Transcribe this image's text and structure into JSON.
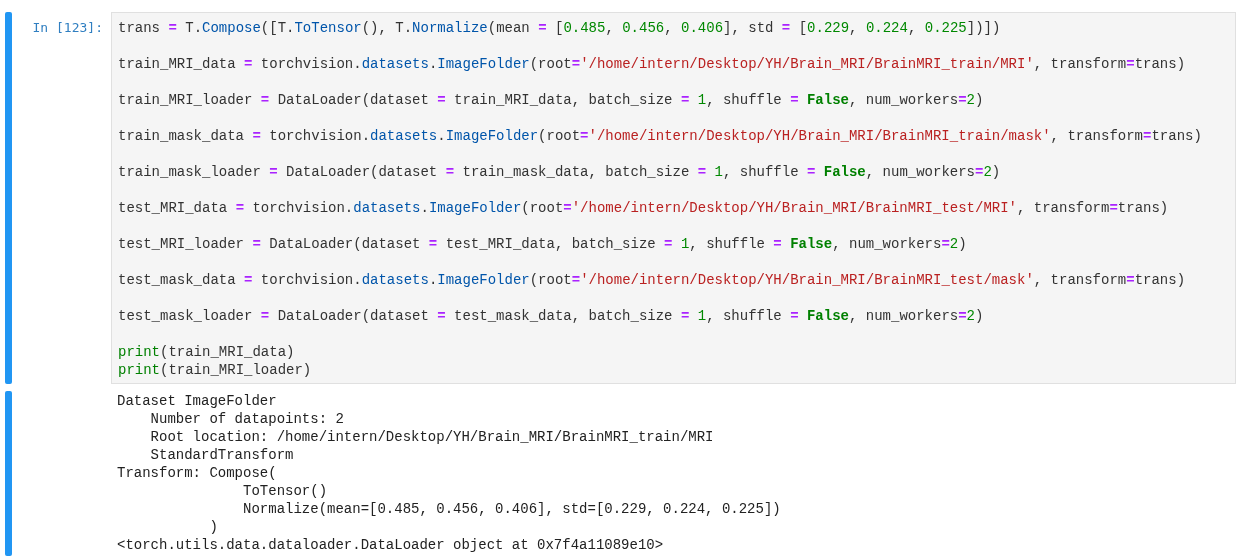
{
  "input_cell": {
    "prompt": "In [123]:",
    "blocks": [
      [
        [
          {
            "kind": "plain",
            "text": "trans "
          },
          {
            "kind": "op",
            "text": "="
          },
          {
            "kind": "plain",
            "text": " T."
          },
          {
            "kind": "prop",
            "text": "Compose"
          },
          {
            "kind": "plain",
            "text": "([T."
          },
          {
            "kind": "prop",
            "text": "ToTensor"
          },
          {
            "kind": "plain",
            "text": "(), T."
          },
          {
            "kind": "prop",
            "text": "Normalize"
          },
          {
            "kind": "plain",
            "text": "(mean "
          },
          {
            "kind": "op",
            "text": "="
          },
          {
            "kind": "plain",
            "text": " ["
          },
          {
            "kind": "num",
            "text": "0.485"
          },
          {
            "kind": "plain",
            "text": ", "
          },
          {
            "kind": "num",
            "text": "0.456"
          },
          {
            "kind": "plain",
            "text": ", "
          },
          {
            "kind": "num",
            "text": "0.406"
          },
          {
            "kind": "plain",
            "text": "], std "
          },
          {
            "kind": "op",
            "text": "="
          },
          {
            "kind": "plain",
            "text": " ["
          },
          {
            "kind": "num",
            "text": "0.229"
          },
          {
            "kind": "plain",
            "text": ", "
          },
          {
            "kind": "num",
            "text": "0.224"
          },
          {
            "kind": "plain",
            "text": ", "
          },
          {
            "kind": "num",
            "text": "0.225"
          },
          {
            "kind": "plain",
            "text": "])])"
          }
        ]
      ],
      [
        [
          {
            "kind": "plain",
            "text": "train_MRI_data "
          },
          {
            "kind": "op",
            "text": "="
          },
          {
            "kind": "plain",
            "text": " torchvision."
          },
          {
            "kind": "prop",
            "text": "datasets"
          },
          {
            "kind": "plain",
            "text": "."
          },
          {
            "kind": "prop",
            "text": "ImageFolder"
          },
          {
            "kind": "plain",
            "text": "(root"
          },
          {
            "kind": "op",
            "text": "="
          },
          {
            "kind": "str",
            "text": "'/home/intern/Desktop/YH/Brain_MRI/BrainMRI_train/MRI'"
          },
          {
            "kind": "plain",
            "text": ", transform"
          },
          {
            "kind": "op",
            "text": "="
          },
          {
            "kind": "plain",
            "text": "trans)"
          }
        ]
      ],
      [
        [
          {
            "kind": "plain",
            "text": "train_MRI_loader "
          },
          {
            "kind": "op",
            "text": "="
          },
          {
            "kind": "plain",
            "text": " DataLoader(dataset "
          },
          {
            "kind": "op",
            "text": "="
          },
          {
            "kind": "plain",
            "text": " train_MRI_data, batch_size "
          },
          {
            "kind": "op",
            "text": "= "
          },
          {
            "kind": "num",
            "text": "1"
          },
          {
            "kind": "plain",
            "text": ", shuffle "
          },
          {
            "kind": "op",
            "text": "= "
          },
          {
            "kind": "kw",
            "text": "False"
          },
          {
            "kind": "plain",
            "text": ", num_workers"
          },
          {
            "kind": "op",
            "text": "="
          },
          {
            "kind": "num",
            "text": "2"
          },
          {
            "kind": "plain",
            "text": ")"
          }
        ]
      ],
      [
        [
          {
            "kind": "plain",
            "text": "train_mask_data "
          },
          {
            "kind": "op",
            "text": "="
          },
          {
            "kind": "plain",
            "text": " torchvision."
          },
          {
            "kind": "prop",
            "text": "datasets"
          },
          {
            "kind": "plain",
            "text": "."
          },
          {
            "kind": "prop",
            "text": "ImageFolder"
          },
          {
            "kind": "plain",
            "text": "(root"
          },
          {
            "kind": "op",
            "text": "="
          },
          {
            "kind": "str",
            "text": "'/home/intern/Desktop/YH/Brain_MRI/BrainMRI_train/mask'"
          },
          {
            "kind": "plain",
            "text": ", transform"
          },
          {
            "kind": "op",
            "text": "="
          },
          {
            "kind": "plain",
            "text": "trans)"
          }
        ]
      ],
      [
        [
          {
            "kind": "plain",
            "text": "train_mask_loader "
          },
          {
            "kind": "op",
            "text": "="
          },
          {
            "kind": "plain",
            "text": " DataLoader(dataset "
          },
          {
            "kind": "op",
            "text": "="
          },
          {
            "kind": "plain",
            "text": " train_mask_data, batch_size "
          },
          {
            "kind": "op",
            "text": "= "
          },
          {
            "kind": "num",
            "text": "1"
          },
          {
            "kind": "plain",
            "text": ", shuffle "
          },
          {
            "kind": "op",
            "text": "= "
          },
          {
            "kind": "kw",
            "text": "False"
          },
          {
            "kind": "plain",
            "text": ", num_workers"
          },
          {
            "kind": "op",
            "text": "="
          },
          {
            "kind": "num",
            "text": "2"
          },
          {
            "kind": "plain",
            "text": ")"
          }
        ]
      ],
      [
        [
          {
            "kind": "plain",
            "text": "test_MRI_data "
          },
          {
            "kind": "op",
            "text": "="
          },
          {
            "kind": "plain",
            "text": " torchvision."
          },
          {
            "kind": "prop",
            "text": "datasets"
          },
          {
            "kind": "plain",
            "text": "."
          },
          {
            "kind": "prop",
            "text": "ImageFolder"
          },
          {
            "kind": "plain",
            "text": "(root"
          },
          {
            "kind": "op",
            "text": "="
          },
          {
            "kind": "str",
            "text": "'/home/intern/Desktop/YH/Brain_MRI/BrainMRI_test/MRI'"
          },
          {
            "kind": "plain",
            "text": ", transform"
          },
          {
            "kind": "op",
            "text": "="
          },
          {
            "kind": "plain",
            "text": "trans)"
          }
        ]
      ],
      [
        [
          {
            "kind": "plain",
            "text": "test_MRI_loader "
          },
          {
            "kind": "op",
            "text": "="
          },
          {
            "kind": "plain",
            "text": " DataLoader(dataset "
          },
          {
            "kind": "op",
            "text": "="
          },
          {
            "kind": "plain",
            "text": " test_MRI_data, batch_size "
          },
          {
            "kind": "op",
            "text": "= "
          },
          {
            "kind": "num",
            "text": "1"
          },
          {
            "kind": "plain",
            "text": ", shuffle "
          },
          {
            "kind": "op",
            "text": "= "
          },
          {
            "kind": "kw",
            "text": "False"
          },
          {
            "kind": "plain",
            "text": ", num_workers"
          },
          {
            "kind": "op",
            "text": "="
          },
          {
            "kind": "num",
            "text": "2"
          },
          {
            "kind": "plain",
            "text": ")"
          }
        ]
      ],
      [
        [
          {
            "kind": "plain",
            "text": "test_mask_data "
          },
          {
            "kind": "op",
            "text": "="
          },
          {
            "kind": "plain",
            "text": " torchvision."
          },
          {
            "kind": "prop",
            "text": "datasets"
          },
          {
            "kind": "plain",
            "text": "."
          },
          {
            "kind": "prop",
            "text": "ImageFolder"
          },
          {
            "kind": "plain",
            "text": "(root"
          },
          {
            "kind": "op",
            "text": "="
          },
          {
            "kind": "str",
            "text": "'/home/intern/Desktop/YH/Brain_MRI/BrainMRI_test/mask'"
          },
          {
            "kind": "plain",
            "text": ", transform"
          },
          {
            "kind": "op",
            "text": "="
          },
          {
            "kind": "plain",
            "text": "trans)"
          }
        ]
      ],
      [
        [
          {
            "kind": "plain",
            "text": "test_mask_loader "
          },
          {
            "kind": "op",
            "text": "="
          },
          {
            "kind": "plain",
            "text": " DataLoader(dataset "
          },
          {
            "kind": "op",
            "text": "="
          },
          {
            "kind": "plain",
            "text": " test_mask_data, batch_size "
          },
          {
            "kind": "op",
            "text": "= "
          },
          {
            "kind": "num",
            "text": "1"
          },
          {
            "kind": "plain",
            "text": ", shuffle "
          },
          {
            "kind": "op",
            "text": "= "
          },
          {
            "kind": "kw",
            "text": "False"
          },
          {
            "kind": "plain",
            "text": ", num_workers"
          },
          {
            "kind": "op",
            "text": "="
          },
          {
            "kind": "num",
            "text": "2"
          },
          {
            "kind": "plain",
            "text": ")"
          }
        ]
      ],
      [
        [
          {
            "kind": "builtin",
            "text": "print"
          },
          {
            "kind": "plain",
            "text": "(train_MRI_data)"
          }
        ],
        [
          {
            "kind": "builtin",
            "text": "print"
          },
          {
            "kind": "plain",
            "text": "(train_MRI_loader)"
          }
        ]
      ]
    ]
  },
  "output_cell": {
    "lines": [
      "Dataset ImageFolder",
      "    Number of datapoints: 2",
      "    Root location: /home/intern/Desktop/YH/Brain_MRI/BrainMRI_train/MRI",
      "    StandardTransform",
      "Transform: Compose(",
      "               ToTensor()",
      "               Normalize(mean=[0.485, 0.456, 0.406], std=[0.229, 0.224, 0.225])",
      "           )",
      "<torch.utils.data.dataloader.DataLoader object at 0x7f4a11089e10>"
    ]
  }
}
